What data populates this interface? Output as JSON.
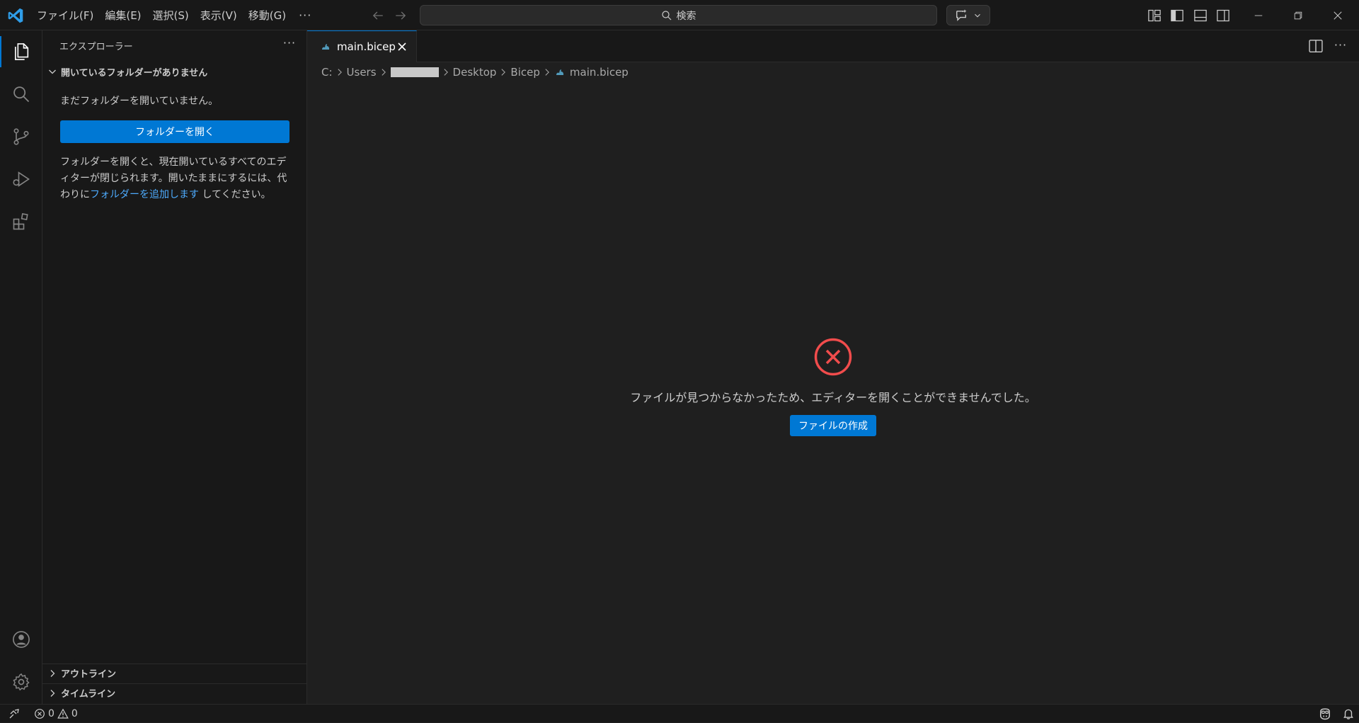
{
  "window": {
    "menu": [
      "ファイル(F)",
      "編集(E)",
      "選択(S)",
      "表示(V)",
      "移動(G)"
    ],
    "menu_more": "···",
    "search_placeholder": "検索"
  },
  "sidebar": {
    "title": "エクスプローラー",
    "more": "···",
    "section_title": "開いているフォルダーがありません",
    "no_folder_text": "まだフォルダーを開いていません。",
    "open_folder_button": "フォルダーを開く",
    "info_text": "フォルダーを開くと、現在開いているすべてのエディターが閉じられます。開いたままにするには、代わりに",
    "info_link": "フォルダーを追加します",
    "info_suffix": " してください。",
    "outline_title": "アウトライン",
    "timeline_title": "タイムライン"
  },
  "editor": {
    "tab_label": "main.bicep",
    "more": "···",
    "breadcrumb": {
      "drive": "C:",
      "users": "Users",
      "desktop": "Desktop",
      "folder": "Bicep",
      "file": "main.bicep"
    },
    "error_message": "ファイルが見つからなかったため、エディターを開くことができませんでした。",
    "create_file_button": "ファイルの作成"
  },
  "statusbar": {
    "errors": "0",
    "warnings": "0"
  },
  "colors": {
    "accent": "#0078d4",
    "error": "#f14c4c",
    "link": "#4daafc",
    "bicep_icon": "#519aba"
  }
}
